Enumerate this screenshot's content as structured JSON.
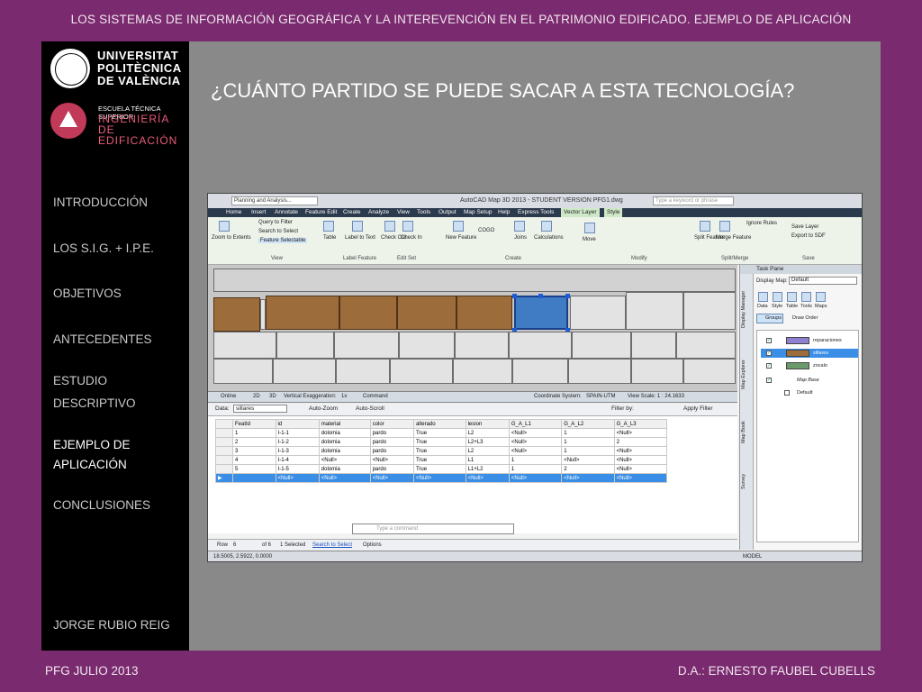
{
  "header": {
    "title": "LOS SISTEMAS DE INFORMACIÓN GEOGRÁFICA Y LA INTEREVENCIÓN EN EL PATRIMONIO EDIFICADO. EJEMPLO DE APLICACIÓN"
  },
  "logos": {
    "upv_lines": [
      "UNIVERSITAT",
      "POLITÈCNICA",
      "DE VALÈNCIA"
    ],
    "school_small": "ESCUELA TÉCNICA SUPERIOR",
    "school_big_1": "INGENIERÍA DE",
    "school_big_2": "EDIFICACIÓN"
  },
  "nav": {
    "items": [
      {
        "label": "INTRODUCCIÓN"
      },
      {
        "label": "LOS S.I.G. + I.P.E."
      },
      {
        "label": "OBJETIVOS"
      },
      {
        "label": "ANTECEDENTES"
      },
      {
        "label": "ESTUDIO"
      },
      {
        "label": "DESCRIPTIVO"
      },
      {
        "label": "EJEMPLO DE"
      },
      {
        "label": "APLICACIÓN"
      },
      {
        "label": "CONCLUSIONES"
      }
    ],
    "author": "JORGE RUBIO REIG"
  },
  "slide": {
    "title": "¿CUÁNTO PARTIDO SE PUEDE SACAR A ESTA TECNOLOGÍA?"
  },
  "app": {
    "workspace": "Planning and Analysis...",
    "title": "AutoCAD Map 3D 2013 - STUDENT VERSION    PFG1.dwg",
    "keyword_placeholder": "Type a keyword or phrase",
    "menu": [
      "Home",
      "Insert",
      "Annotate",
      "Feature Edit",
      "Create",
      "Analyze",
      "View",
      "Tools",
      "Output",
      "Map Setup",
      "Help",
      "Express Tools",
      "Vector Layer",
      "Style"
    ],
    "ribbon": {
      "buttons": [
        "Zoom to Extents",
        "Query to Filter",
        "Search to Select",
        "Feature Selectable",
        "Table",
        "Label to Text",
        "Check Out",
        "Check In",
        "New Feature",
        "COGO",
        "Joins",
        "Calculations",
        "Move",
        "Split Feature",
        "Merge Feature",
        "Ignore Rules",
        "Save Layer",
        "Export to SDF"
      ],
      "groups": [
        "View",
        "Label Feature",
        "Edit Set",
        "Create",
        "Modify",
        "Split/Merge",
        "Save"
      ]
    },
    "map_status": {
      "online": "Online",
      "btn_2d": "2D",
      "btn_3d": "3D",
      "vert_exag": "Vertical Exaggeration:",
      "vert_val": "1x",
      "command": "Command",
      "coord_system": "Coordinate System:",
      "coord_val": "SPAIN-UTM",
      "view_scale": "View Scale: 1 : 24.1633"
    },
    "table": {
      "data_label": "Data:",
      "data_value": "sillares",
      "auto_zoom": "Auto-Zoom",
      "auto_scroll": "Auto-Scroll",
      "filter_by": "Filter by:",
      "apply_filter": "Apply Filter",
      "columns": [
        "FeatId",
        "id",
        "material",
        "color",
        "alterado",
        "lesion",
        "G_A_L1",
        "G_A_L2",
        "G_A_L3"
      ],
      "rows": [
        [
          "1",
          "I-1-1",
          "dolomia",
          "pardo",
          "True",
          "L2",
          "<Null>",
          "1",
          "<Null>"
        ],
        [
          "2",
          "I-1-2",
          "dolomia",
          "pardo",
          "True",
          "L2+L3",
          "<Null>",
          "1",
          "2"
        ],
        [
          "3",
          "I-1-3",
          "dolomia",
          "pardo",
          "True",
          "L2",
          "<Null>",
          "1",
          "<Null>"
        ],
        [
          "4",
          "I-1-4",
          "<Null>",
          "<Null>",
          "True",
          "L1",
          "1",
          "<Null>",
          "<Null>"
        ],
        [
          "5",
          "I-1-5",
          "dolomia",
          "pardo",
          "True",
          "L1+L2",
          "1",
          "2",
          "<Null>"
        ],
        [
          "",
          "<Null>",
          "<Null>",
          "<Null>",
          "<Null>",
          "<Null>",
          "<Null>",
          "<Null>",
          "<Null>"
        ]
      ],
      "command_placeholder": "Type a command",
      "row_label": "Row",
      "row_value": "6",
      "of_label": "of 6",
      "selected": "1 Selected",
      "search_to_select": "Search to Select",
      "options": "Options"
    },
    "coords": "18.5005, 2.5922, 0.0000",
    "model": "MODEL",
    "task_pane": {
      "title": "Task Pane",
      "tabs": [
        "Display Manager",
        "Map Explorer",
        "Map Book",
        "Survey"
      ],
      "display_map_label": "Display Map:",
      "display_map_value": "Default",
      "tools": [
        "Data",
        "Style",
        "Table",
        "Tools",
        "Maps"
      ],
      "groups_btn": "Groups",
      "draw_order": "Draw Order",
      "layers": [
        {
          "name": "reparaciones",
          "color": "#8f7fd0",
          "checked": "✓"
        },
        {
          "name": "sillares",
          "color": "#9c6d3a",
          "checked": "✓"
        },
        {
          "name": "zocalo",
          "color": "#6a9a6a",
          "checked": "✓"
        },
        {
          "name": "Map Base",
          "color": "",
          "checked": "✓"
        },
        {
          "name": "Default",
          "color": "",
          "checked": ""
        }
      ]
    }
  },
  "footer": {
    "left": "PFG JULIO 2013",
    "right": "D.A.: ERNESTO FAUBEL CUBELLS"
  }
}
